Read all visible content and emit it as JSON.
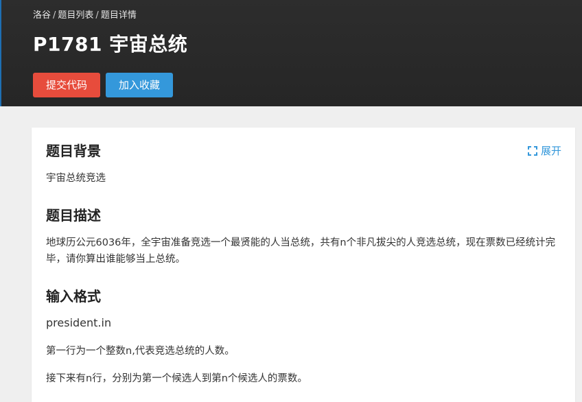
{
  "breadcrumb": {
    "items": [
      "洛谷",
      "题目列表",
      "题目详情"
    ],
    "separator": "/"
  },
  "problem": {
    "title": "P1781 宇宙总统"
  },
  "actions": {
    "submit_label": "提交代码",
    "favorite_label": "加入收藏"
  },
  "content": {
    "expand_label": "展开",
    "sections": [
      {
        "heading": "题目背景",
        "paragraphs": [
          "宇宙总统竞选"
        ]
      },
      {
        "heading": "题目描述",
        "paragraphs": [
          "地球历公元6036年，全宇宙准备竞选一个最贤能的人当总统，共有n个非凡拔尖的人竞选总统，现在票数已经统计完毕，请你算出谁能够当上总统。"
        ]
      },
      {
        "heading": "输入格式",
        "paragraphs": [
          "president.in",
          "第一行为一个整数n,代表竞选总统的人数。",
          "接下来有n行，分别为第一个候选人到第n个候选人的票数。"
        ]
      }
    ]
  },
  "colors": {
    "header_bg": "#2b2b2b",
    "submit": "#e74c3c",
    "favorite": "#3498db",
    "link": "#3498db",
    "page_bg": "#efefef"
  }
}
